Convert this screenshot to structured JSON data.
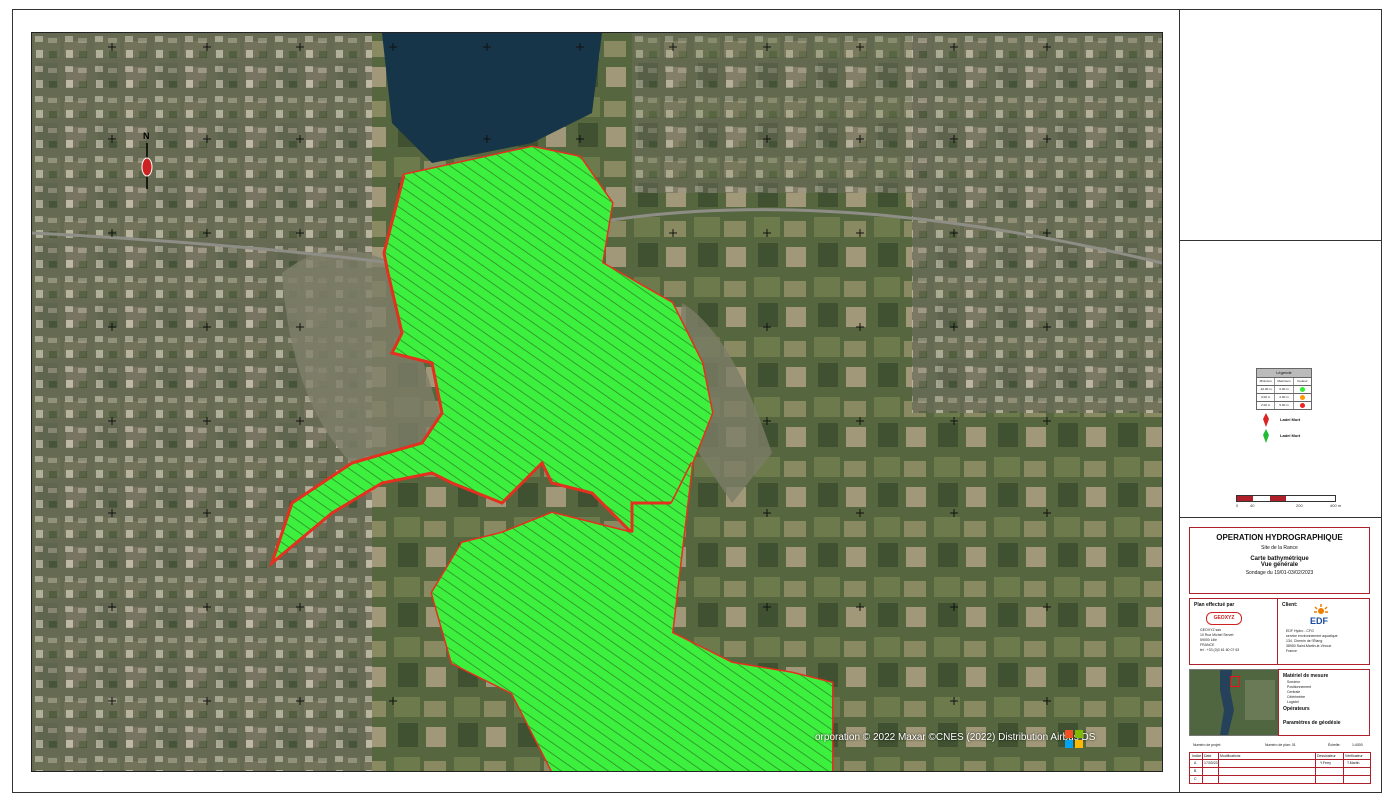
{
  "credit": "orporation © 2022 Maxar ©CNES (2022) Distribution Airbus DS",
  "north_label": "N",
  "legend": {
    "title": "Légende",
    "headers": [
      "Minimum",
      "Maximum",
      "Couleur"
    ],
    "rows": [
      {
        "min": "-10.00 m",
        "max": "0.00 m",
        "color": "#33ee33"
      },
      {
        "min": "0.00 m",
        "max": "2.00 m",
        "color": "#ff9900"
      },
      {
        "min": "2.00 m",
        "max": "5.00 m",
        "color": "#ee2222"
      }
    ]
  },
  "markers": {
    "red": "Ladel Mort",
    "green": "Ladel Mort"
  },
  "scale": {
    "labels": [
      "0",
      "40",
      "200",
      "400 m"
    ]
  },
  "title_block": {
    "title": "OPERATION HYDROGRAPHIQUE",
    "site": "Site de la Rance",
    "chart_title": "Carte bathymétrique",
    "view": "Vue générale",
    "date": "Sondage du 19/01-03/02/2023"
  },
  "performed_by": {
    "heading": "Plan effectué par",
    "logo": "GEOXYZ",
    "lines": [
      "GEOXYZ sas",
      "10 Rue Michel Servet",
      "59000 Lille",
      "FRANCE",
      "tel : +33 (0)3 61 60 07 63"
    ]
  },
  "client": {
    "heading": "Client:",
    "logo": "EDF",
    "lines": [
      "EDF Hydro - CFG",
      "service environnement aquatique",
      "134, Chemin de l'Étang",
      "38950 Saint-Martin-le-Vinoux",
      "France"
    ]
  },
  "equipment": {
    "heading": "Matériel de mesure",
    "items": [
      "Sondeur",
      "Positionnement",
      "Centrale",
      "Célérimètre",
      "Logiciel"
    ],
    "ops_heading": "Opérateurs",
    "geo_heading": "Paramètres de géodésie"
  },
  "revision": {
    "top": [
      "Numéro de projet: ",
      "Numéro de plan: 01",
      "Échelle: ",
      "1:4000"
    ],
    "headers": [
      "Indice",
      "Date",
      "Modifications",
      "Dessinateur",
      "Vérificateur"
    ],
    "rows": [
      [
        "A",
        "17/03/23",
        "",
        "Y.Ferry",
        "T.Martin"
      ],
      [
        "B",
        "",
        "",
        "",
        ""
      ],
      [
        "C",
        "",
        "",
        "",
        ""
      ]
    ]
  },
  "colors": {
    "depth_green": "#3ef03e",
    "edge_orange": "#ff9900",
    "edge_red": "#e3301f",
    "water": "#163548",
    "frame_red": "#b0202a"
  }
}
